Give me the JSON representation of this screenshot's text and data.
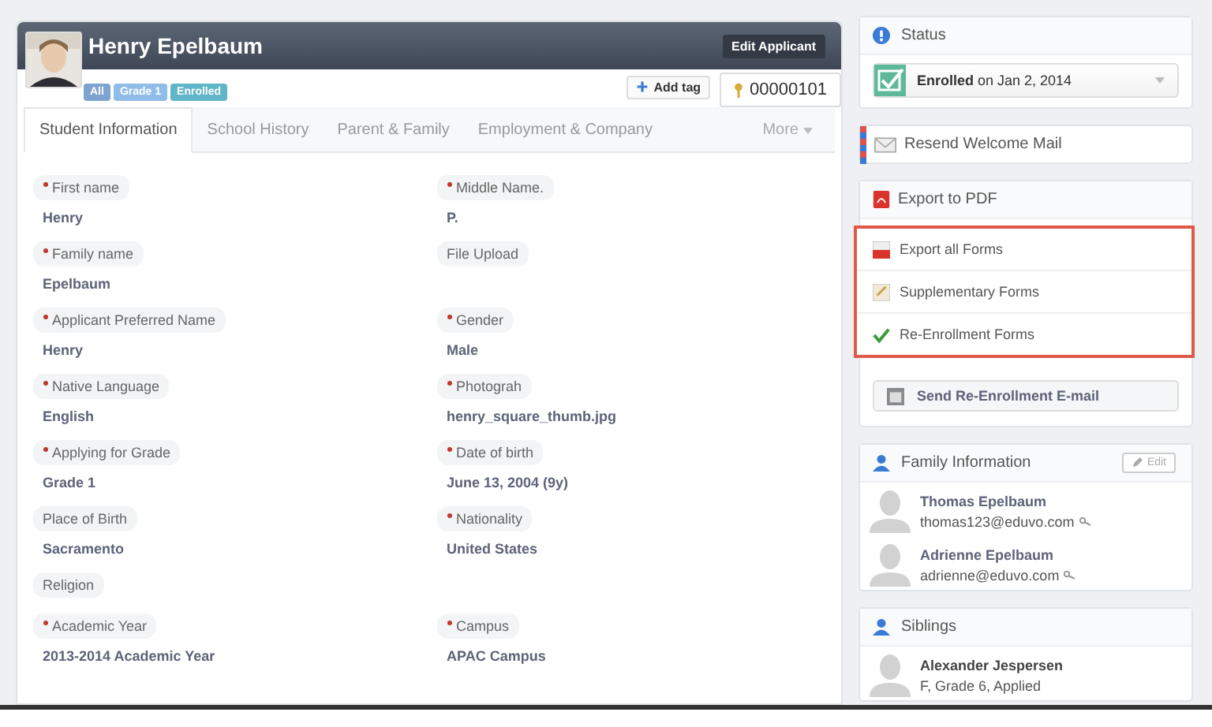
{
  "applicant": {
    "name": "Henry Epelbaum",
    "edit_button": "Edit Applicant",
    "add_tag_button": "Add tag",
    "id": "00000101",
    "tags": [
      {
        "label": "All",
        "color": "#7fa3cf"
      },
      {
        "label": "Grade 1",
        "color": "#8fbde8"
      },
      {
        "label": "Enrolled",
        "color": "#5fb6c9"
      }
    ]
  },
  "tabs": [
    {
      "label": "Student Information",
      "selected": true
    },
    {
      "label": "School History",
      "selected": false
    },
    {
      "label": "Parent & Family",
      "selected": false
    },
    {
      "label": "Employment & Company",
      "selected": false
    }
  ],
  "more_tab": "More",
  "rows": [
    [
      {
        "label": "First name",
        "required": true,
        "value": "Henry"
      },
      {
        "label": "Middle Name.",
        "required": true,
        "value": "P."
      }
    ],
    [
      {
        "label": "Family name",
        "required": true,
        "value": "Epelbaum"
      },
      {
        "label": "File Upload",
        "required": false
      }
    ],
    [
      {
        "label": "Applicant Preferred Name",
        "required": true,
        "value": "Henry"
      },
      {
        "label": "Gender",
        "required": true,
        "value": "Male"
      }
    ],
    [
      {
        "label": "Native Language",
        "required": true,
        "value": "English"
      },
      {
        "label": "Photograh",
        "required": true,
        "value": "henry_square_thumb.jpg"
      }
    ],
    [
      {
        "label": "Applying for Grade",
        "required": true,
        "value": "Grade 1"
      },
      {
        "label": "Date of birth",
        "required": true,
        "value": "June 13, 2004 (9y)"
      }
    ],
    [
      {
        "label": "Place of Birth",
        "required": false,
        "value": "Sacramento"
      },
      {
        "label": "Nationality",
        "required": true,
        "value": "United States"
      }
    ],
    [
      {
        "label": "Religion",
        "required": false
      }
    ],
    [
      {
        "label": "Academic Year",
        "required": true,
        "value": "2013-2014 Academic Year"
      },
      {
        "label": "Campus",
        "required": true,
        "value": "APAC Campus"
      }
    ]
  ],
  "status": {
    "title": "Status",
    "value": "**Enrolled** on Jan 2, 2014"
  },
  "resend_button": "Resend Welcome Mail",
  "export": {
    "title": "Export to PDF",
    "menu": [
      {
        "label": "Export all Forms",
        "kind": "pdf"
      },
      {
        "label": "Supplementary Forms",
        "kind": "note"
      },
      {
        "label": "Re-Enrollment Forms",
        "kind": "check"
      }
    ],
    "send_button": "Send Re-Enrollment E-mail"
  },
  "family": {
    "title": "Family Information",
    "edit_button": "Edit",
    "members": [
      {
        "name": "Thomas Epelbaum",
        "email": "thomas123@eduvo.com"
      },
      {
        "name": "Adrienne Epelbaum",
        "email": "adrienne@eduvo.com"
      }
    ]
  },
  "siblings": {
    "title": "Siblings",
    "members": [
      {
        "name": "Alexander Jespersen",
        "detail": "F, Grade 6, Applied"
      }
    ]
  }
}
